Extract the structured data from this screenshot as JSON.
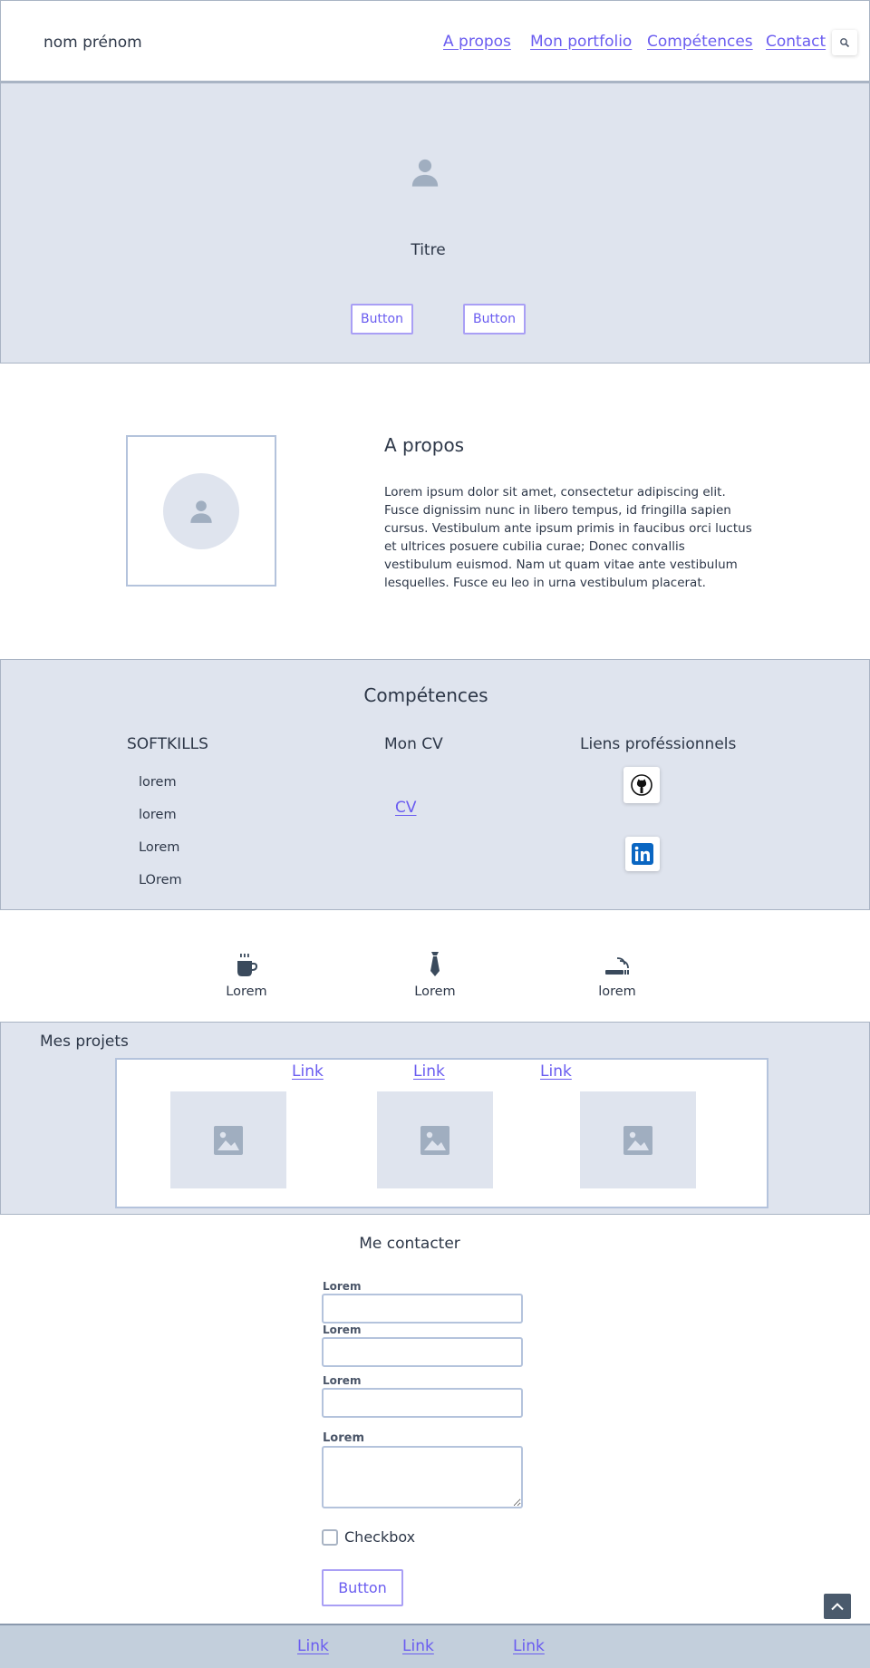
{
  "header": {
    "brand": "nom prénom",
    "nav": [
      "A propos",
      "Mon portfolio",
      "Compétences",
      "Contact"
    ],
    "search_icon": "search-icon"
  },
  "hero": {
    "title": "Titre",
    "buttons": [
      "Button",
      "Button"
    ]
  },
  "about": {
    "title": "A propos",
    "text": "Lorem ipsum dolor sit amet, consectetur adipiscing elit. Fusce dignissim nunc in libero tempus, id fringilla sapien cursus. Vestibulum ante ipsum primis in faucibus orci luctus et ultrices posuere cubilia curae; Donec convallis vestibulum euismod. Nam ut quam vitae ante vestibulum lesquelles. Fusce eu leo in urna vestibulum placerat."
  },
  "skills": {
    "title": "Compétences",
    "softskills": {
      "heading": "SOFTKILLS",
      "items": [
        "lorem",
        "lorem",
        "Lorem",
        "LOrem"
      ]
    },
    "cv": {
      "heading": "Mon CV",
      "link": "CV"
    },
    "links": {
      "heading": "Liens proféssionnels",
      "icons": [
        "github-icon",
        "linkedin-icon"
      ]
    }
  },
  "interests": [
    {
      "icon": "coffee-icon",
      "label": "Lorem"
    },
    {
      "icon": "tie-icon",
      "label": "Lorem"
    },
    {
      "icon": "smoking-icon",
      "label": "lorem"
    }
  ],
  "projects": {
    "title": "Mes projets",
    "links": [
      "Link",
      "Link",
      "Link"
    ]
  },
  "contact": {
    "title": "Me contacter",
    "fields": [
      "Lorem",
      "Lorem",
      "Lorem"
    ],
    "textarea_label": "Lorem",
    "checkbox_label": "Checkbox",
    "submit": "Button"
  },
  "footer": {
    "links": [
      "Link",
      "Link",
      "Link"
    ]
  },
  "colors": {
    "accent": "#6a5cf0",
    "band": "#dfe4ee",
    "border": "#a9b4c4",
    "footer": "#c3cfdc"
  }
}
